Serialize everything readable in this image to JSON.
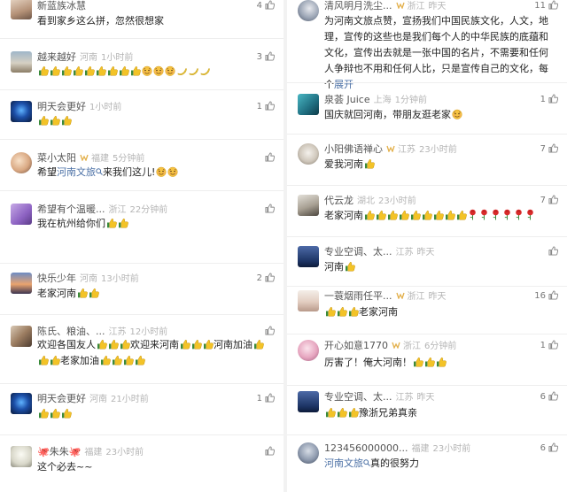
{
  "left": [
    {
      "user": "新蓝族冰慧",
      "vip": "",
      "loc": "",
      "time": "",
      "likes": "4",
      "body": "看到家乡这么拼，忽然很想家",
      "avatar": "avatar-photo-child"
    },
    {
      "user": "越来越好",
      "vip": "",
      "loc": "河南",
      "time": "1小时前",
      "likes": "3",
      "body_html": "t×9 f f f b b b",
      "avatar": "avatar-photo-beach"
    },
    {
      "user": "明天会更好",
      "vip": "",
      "loc": "",
      "time": "1小时前",
      "likes": "1",
      "body_html": "t×3",
      "avatar": "avatar-photo-blue"
    },
    {
      "user": "菜小太阳",
      "vip": "v",
      "loc": "福建",
      "time": "5分钟前",
      "likes": "",
      "body_pre": "希望",
      "body_link": "河南文旅",
      "body_post": "来我们这儿!",
      "avatar": "avatar-photo-cartoon"
    },
    {
      "user": "希望有个温暖...",
      "vip": "",
      "loc": "浙江",
      "time": "22分钟前",
      "likes": "",
      "body": "我在杭州给你们",
      "avatar": "avatar-photo-purple"
    },
    {
      "user": "快乐少年",
      "vip": "",
      "loc": "河南",
      "time": "13小时前",
      "likes": "2",
      "body": "老家河南",
      "avatar": "avatar-photo-sunset"
    },
    {
      "user": "陈氏、粮油、...",
      "vip": "",
      "loc": "江苏",
      "time": "12小时前",
      "likes": "",
      "body": "欢迎各国友人",
      "body2": "欢迎来河南",
      "body3": "河南加油",
      "body4": "老家加油",
      "avatar": "avatar-photo-group"
    },
    {
      "user": "明天会更好",
      "vip": "",
      "loc": "河南",
      "time": "21小时前",
      "likes": "1",
      "body_html": "t×3",
      "avatar": "avatar-photo-blue"
    },
    {
      "user": "朱朱",
      "vip": "",
      "loc": "福建",
      "time": "23小时前",
      "likes": "",
      "body": "这个必去~~",
      "avatar": "avatar-photo-cartoon2"
    }
  ],
  "right": [
    {
      "user": "清风明月洗尘...",
      "vip": "v",
      "loc": "浙江",
      "time": "昨天",
      "likes": "11",
      "body": "为河南文旅点赞，宣扬我们中国民族文化，人文，地理，宣传的这些也是我们每个人的中华民族的底蕴和文化，宣传出去就是一张中国的名片，不需要和任何人争辩也不用和任何人比，只是宣传自己的文化，每个",
      "expand": "展开",
      "avatar": "avatar-photo-moon"
    },
    {
      "user": "泉荟 Juice",
      "vip": "",
      "loc": "上海",
      "time": "1分钟前",
      "likes": "1",
      "body": "国庆就回河南，带朋友逛老家",
      "avatar": "avatar-photo-sea"
    },
    {
      "user": "小阳佛语禅心",
      "vip": "v",
      "loc": "江苏",
      "time": "23小时前",
      "likes": "7",
      "body": "爱我河南",
      "avatar": "avatar-photo-smile"
    },
    {
      "user": "代云龙",
      "vip": "",
      "loc": "湖北",
      "time": "23小时前",
      "likes": "7",
      "body": "老家河南",
      "avatar": "avatar-photo-man"
    },
    {
      "user": "专业空调、太...",
      "vip": "",
      "loc": "江苏",
      "time": "昨天",
      "likes": "",
      "body": "河南",
      "avatar": "avatar-photo-navy"
    },
    {
      "user": "一蓑烟雨任平...",
      "vip": "v",
      "loc": "浙江",
      "time": "昨天",
      "likes": "16",
      "body": "老家河南",
      "avatar": "avatar-photo-kids"
    },
    {
      "user": "开心如意1770",
      "vip": "v",
      "loc": "浙江",
      "time": "6分钟前",
      "likes": "1",
      "body": "厉害了！俺大河南！",
      "avatar": "avatar-photo-blossom"
    },
    {
      "user": "专业空调、太...",
      "vip": "",
      "loc": "江苏",
      "time": "昨天",
      "likes": "6",
      "body": "豫浙兄弟真亲",
      "avatar": "avatar-photo-navy"
    },
    {
      "user": "123456000000...",
      "vip": "",
      "loc": "福建",
      "time": "23小时前",
      "likes": "6",
      "body_link": "河南文旅",
      "body_post": "真的很努力",
      "avatar": "avatar-photo-person"
    }
  ]
}
